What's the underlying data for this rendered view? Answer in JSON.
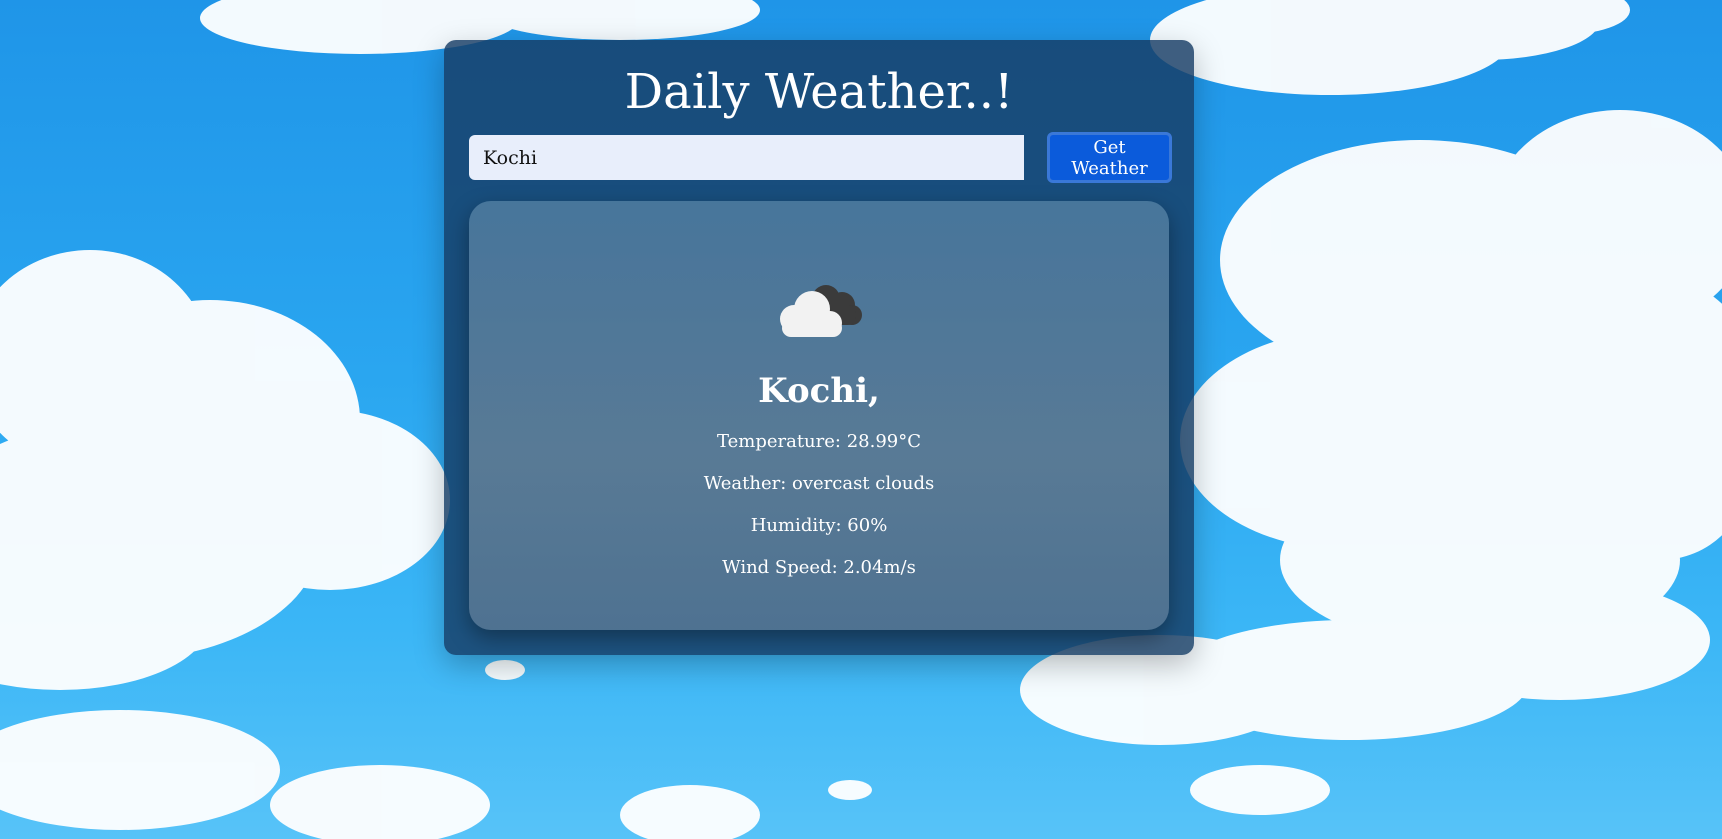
{
  "app": {
    "title": "Daily Weather..!"
  },
  "search": {
    "value": "Kochi",
    "button_label": "Get Weather"
  },
  "weather": {
    "icon": "overcast-cloud-icon",
    "city": "Kochi,",
    "temperature": "Temperature: 28.99°C",
    "description": "Weather: overcast clouds",
    "humidity": "Humidity: 60%",
    "wind_speed": "Wind Speed: 2.04m/s"
  },
  "colors": {
    "sky_top": "#1f95e8",
    "sky_bottom": "#57c3f8",
    "panel": "#163c64",
    "button": "#0b5bdb",
    "input_bg": "#e8eefb"
  }
}
